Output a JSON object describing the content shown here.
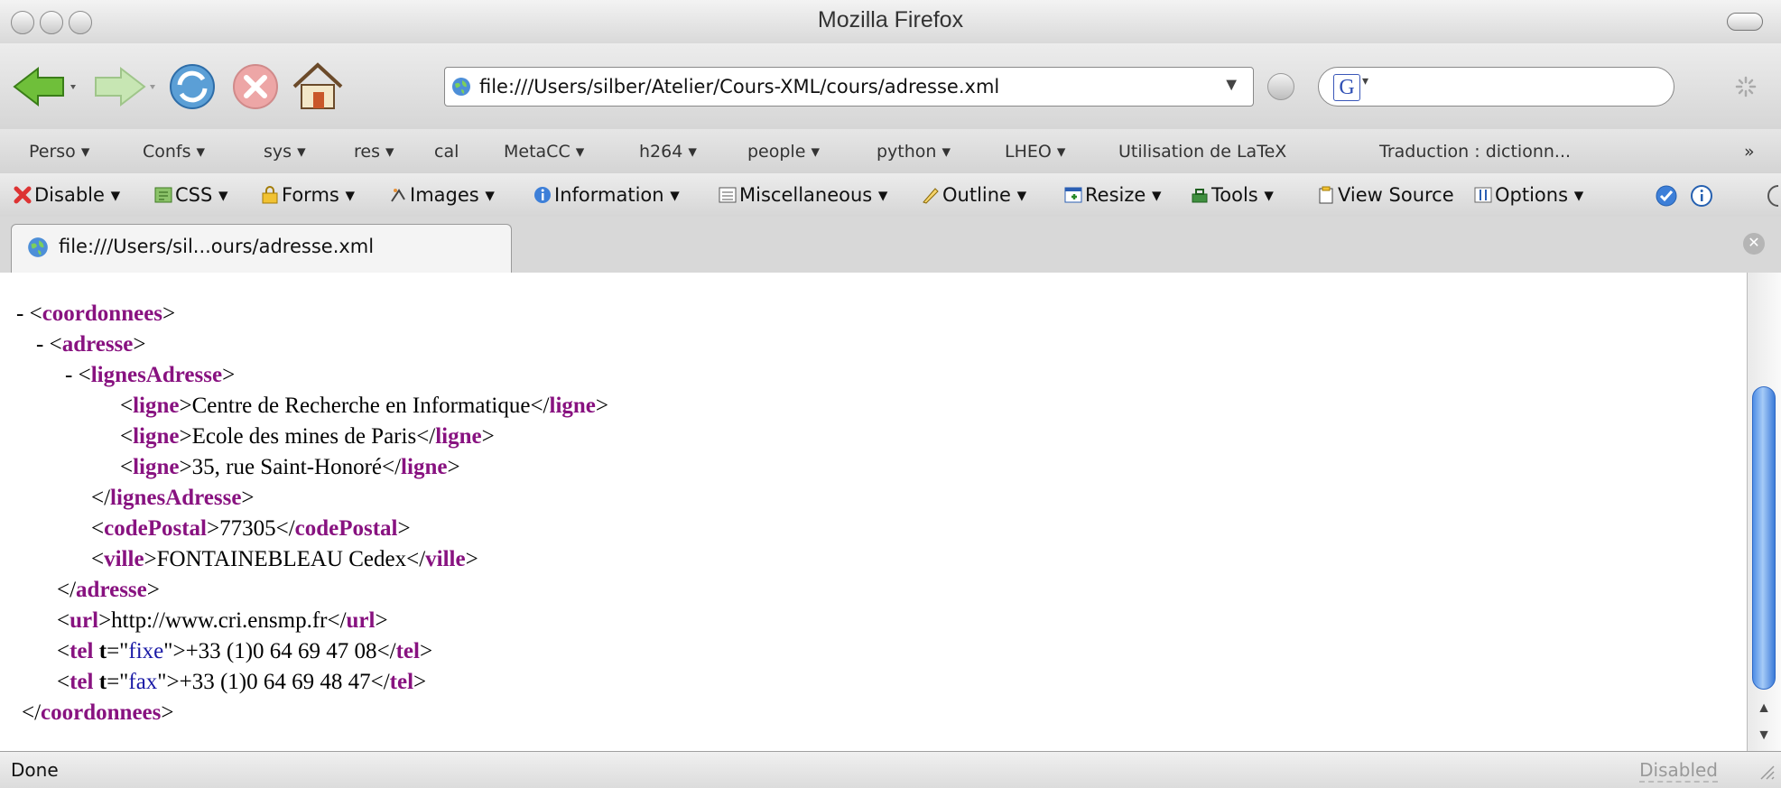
{
  "window": {
    "title": "Mozilla Firefox"
  },
  "navbar": {
    "url": "file:///Users/silber/Atelier/Cours-XML/cours/adresse.xml",
    "search_placeholder": ""
  },
  "bookmarks": [
    {
      "label": "Perso ▾"
    },
    {
      "label": "Confs ▾"
    },
    {
      "label": "sys ▾"
    },
    {
      "label": "res ▾"
    },
    {
      "label": "cal"
    },
    {
      "label": "MetaCC ▾"
    },
    {
      "label": "h264 ▾"
    },
    {
      "label": "people ▾"
    },
    {
      "label": "python ▾"
    },
    {
      "label": "LHEO ▾"
    },
    {
      "label": "Utilisation de LaTeX"
    },
    {
      "label": "Traduction : dictionn..."
    }
  ],
  "bookmarks_overflow": "»",
  "devtools": [
    {
      "label": "Disable",
      "icon": "disable-icon"
    },
    {
      "label": "CSS",
      "icon": "css-icon"
    },
    {
      "label": "Forms",
      "icon": "forms-icon"
    },
    {
      "label": "Images",
      "icon": "images-icon"
    },
    {
      "label": "Information",
      "icon": "information-icon"
    },
    {
      "label": "Miscellaneous",
      "icon": "miscellaneous-icon"
    },
    {
      "label": "Outline",
      "icon": "outline-icon"
    },
    {
      "label": "Resize",
      "icon": "resize-icon"
    },
    {
      "label": "Tools",
      "icon": "tools-icon"
    },
    {
      "label": "View Source",
      "icon": "view-source-icon"
    },
    {
      "label": "Options",
      "icon": "options-icon"
    }
  ],
  "tab": {
    "label": "file:///Users/sil...ours/adresse.xml"
  },
  "xml": {
    "l1": {
      "prefix": "- <",
      "tag": "coordonnees",
      "suffix": ">"
    },
    "l2": {
      "prefix": "- <",
      "tag": "adresse",
      "suffix": ">"
    },
    "l3": {
      "prefix": "- <",
      "tag": "lignesAdresse",
      "suffix": ">"
    },
    "l4": {
      "open": "ligne",
      "text": "Centre de Recherche en Informatique",
      "close": "ligne"
    },
    "l5": {
      "open": "ligne",
      "text": "Ecole des mines de Paris",
      "close": "ligne"
    },
    "l6": {
      "open": "ligne",
      "text": "35, rue Saint-Honoré",
      "close": "ligne"
    },
    "l7": {
      "tag": "lignesAdresse"
    },
    "l8": {
      "open": "codePostal",
      "text": "77305",
      "close": "codePostal"
    },
    "l9": {
      "open": "ville",
      "text": "FONTAINEBLEAU Cedex",
      "close": "ville"
    },
    "l10": {
      "tag": "adresse"
    },
    "l11": {
      "open": "url",
      "text": "http://www.cri.ensmp.fr",
      "close": "url"
    },
    "l12": {
      "tag": "tel",
      "attr": "t",
      "value": "fixe",
      "text": "+33 (1)0 64 69 47 08",
      "close": "tel"
    },
    "l13": {
      "tag": "tel",
      "attr": "t",
      "value": "fax",
      "text": "+33 (1)0 64 69 48 47",
      "close": "tel"
    },
    "l14": {
      "tag": "coordonnees"
    }
  },
  "status": {
    "text": "Done",
    "right": "Disabled"
  }
}
